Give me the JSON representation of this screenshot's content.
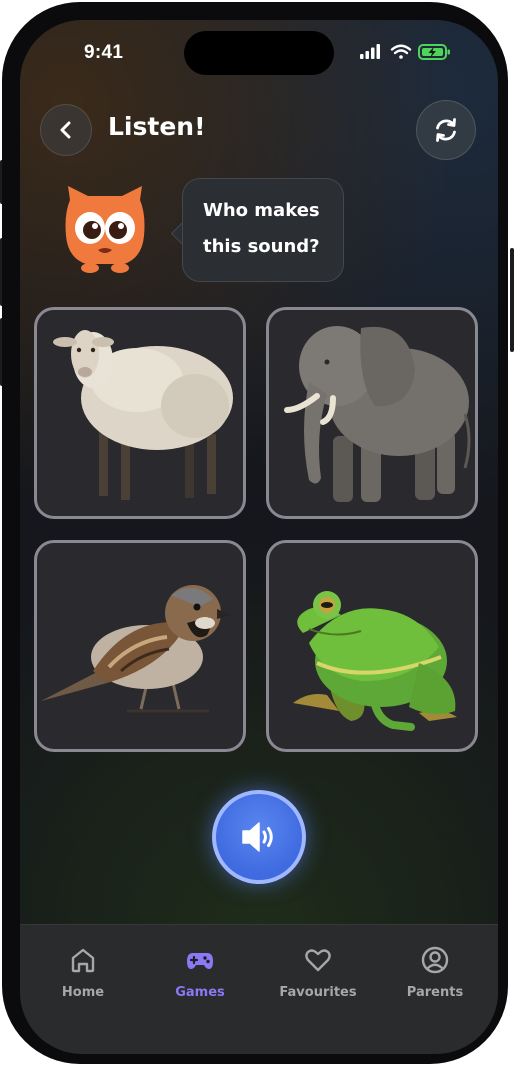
{
  "status_bar": {
    "time": "9:41"
  },
  "header": {
    "title": "Listen!",
    "back_icon": "chevron-left-icon",
    "refresh_icon": "refresh-icon"
  },
  "prompt": {
    "line1": "Who makes",
    "line2": "this sound?",
    "mascot": "owl-mascot"
  },
  "answers": [
    {
      "animal": "sheep"
    },
    {
      "animal": "elephant"
    },
    {
      "animal": "sparrow"
    },
    {
      "animal": "frog"
    }
  ],
  "sound_button": {
    "icon": "speaker-icon",
    "color": "#4a74e8"
  },
  "tabbar": {
    "items": [
      {
        "label": "Home",
        "icon": "home-icon"
      },
      {
        "label": "Games",
        "icon": "gamepad-icon",
        "active": true
      },
      {
        "label": "Favourites",
        "icon": "heart-icon"
      },
      {
        "label": "Parents",
        "icon": "user-circle-icon"
      }
    ],
    "active_color": "#8a78f5"
  }
}
